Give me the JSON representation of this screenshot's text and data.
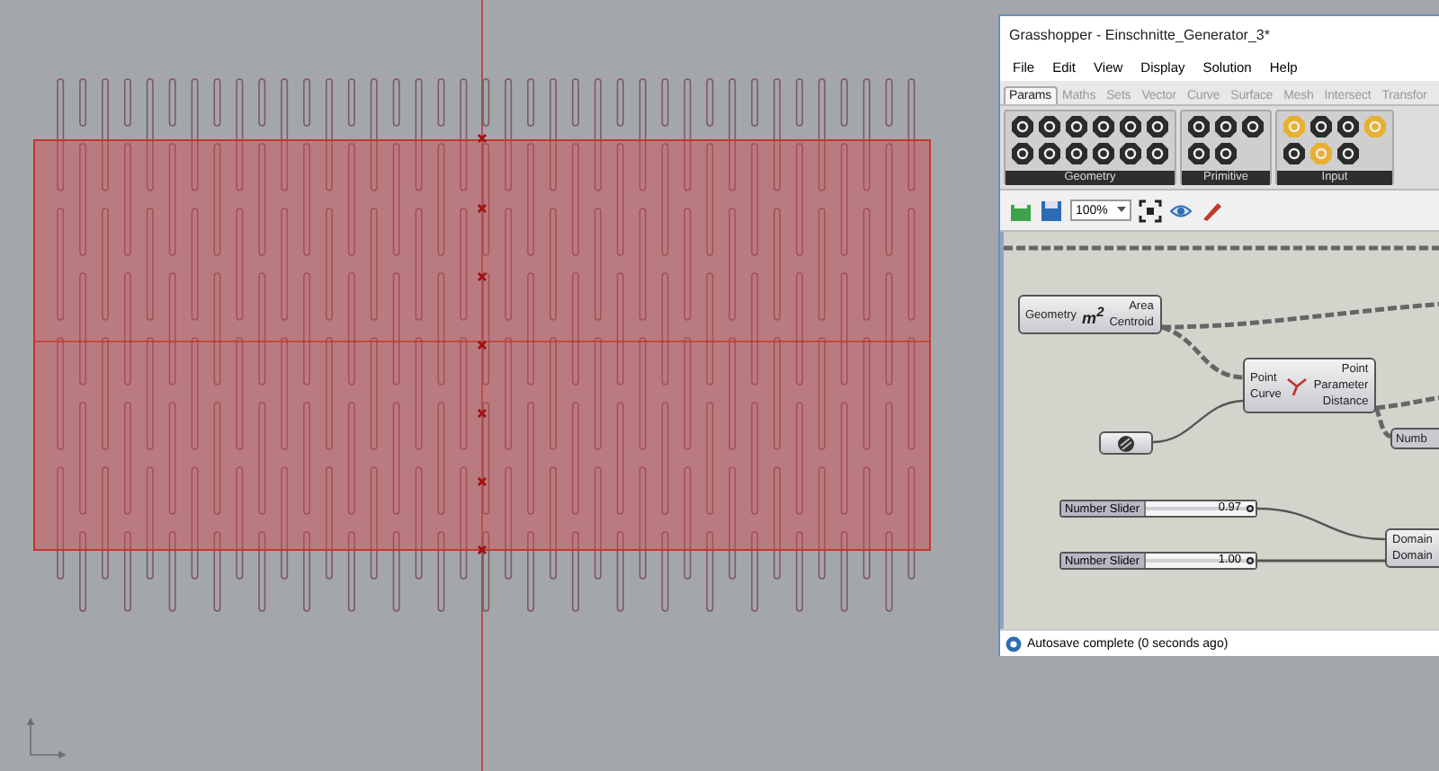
{
  "window": {
    "title": "Grasshopper - Einschnitte_Generator_3*"
  },
  "menu": [
    "File",
    "Edit",
    "View",
    "Display",
    "Solution",
    "Help"
  ],
  "tabs": [
    {
      "label": "Params",
      "selected": true
    },
    {
      "label": "Maths",
      "selected": false
    },
    {
      "label": "Sets",
      "selected": false
    },
    {
      "label": "Vector",
      "selected": false
    },
    {
      "label": "Curve",
      "selected": false
    },
    {
      "label": "Surface",
      "selected": false
    },
    {
      "label": "Mesh",
      "selected": false
    },
    {
      "label": "Intersect",
      "selected": false
    },
    {
      "label": "Transfor",
      "selected": false
    }
  ],
  "palette_groups": [
    "Geometry",
    "Primitive",
    "Input"
  ],
  "toolbar": {
    "zoom": "100%"
  },
  "nodes": [
    {
      "kind": "component",
      "inputs": [
        "Geometry"
      ],
      "icon_text": "m$^{2}$",
      "outputs": [
        "Area",
        "Centroid"
      ]
    },
    {
      "kind": "component",
      "inputs": [
        "Point",
        "Curve"
      ],
      "outputs": [
        "Point",
        "Parameter",
        "Distance"
      ]
    },
    {
      "kind": "param"
    },
    {
      "kind": "label",
      "label": "Numb"
    },
    {
      "kind": "component",
      "inputs": [
        "Domain",
        "Domain"
      ]
    }
  ],
  "sliders": [
    {
      "label": "Number Slider",
      "value": "0.97",
      "level": 0.97
    },
    {
      "label": "Number Slider",
      "value": "1.00",
      "level": 1.0
    }
  ],
  "status_bar": {
    "text": "Autosave complete (0 seconds ago)"
  }
}
